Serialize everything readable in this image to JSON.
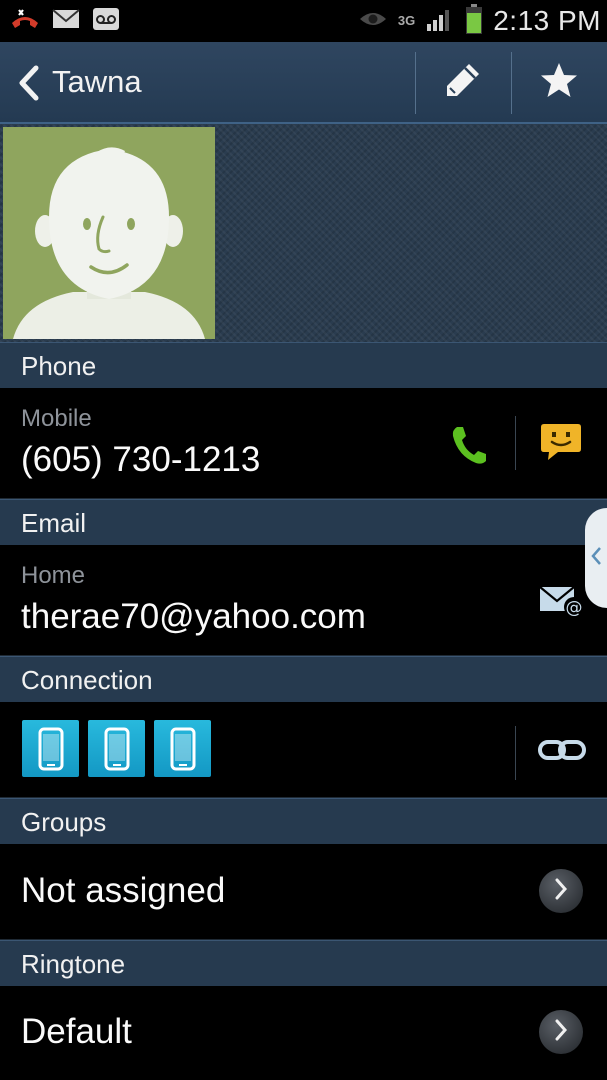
{
  "status_bar": {
    "network": "3G",
    "time": "2:13 PM",
    "icons": [
      "missed-call-icon",
      "email-icon",
      "voicemail-icon",
      "eye-icon",
      "signal-icon",
      "battery-icon"
    ]
  },
  "action_bar": {
    "contact_name": "Tawna",
    "icons": [
      "back-icon",
      "edit-icon",
      "star-icon"
    ]
  },
  "phone_section": {
    "header": "Phone",
    "type_label": "Mobile",
    "number": "(605) 730-1213",
    "icons": [
      "call-icon",
      "message-icon"
    ],
    "call_icon_color": "#5cc020",
    "message_icon_color": "#f0b428"
  },
  "email_section": {
    "header": "Email",
    "type_label": "Home",
    "address": "therae70@yahoo.com",
    "icons": [
      "send-email-icon"
    ]
  },
  "connection_section": {
    "header": "Connection",
    "devices": [
      "phone-device-icon",
      "phone-device-icon",
      "phone-device-icon"
    ],
    "icons": [
      "link-icon"
    ],
    "device_color": "#1ea9d3"
  },
  "groups_section": {
    "header": "Groups",
    "value": "Not assigned"
  },
  "ringtone_section": {
    "header": "Ringtone",
    "value": "Default"
  },
  "colors": {
    "action_bar": "#2a4058",
    "section_header": "#263a4f",
    "avatar_bg": "#8fa55e"
  }
}
